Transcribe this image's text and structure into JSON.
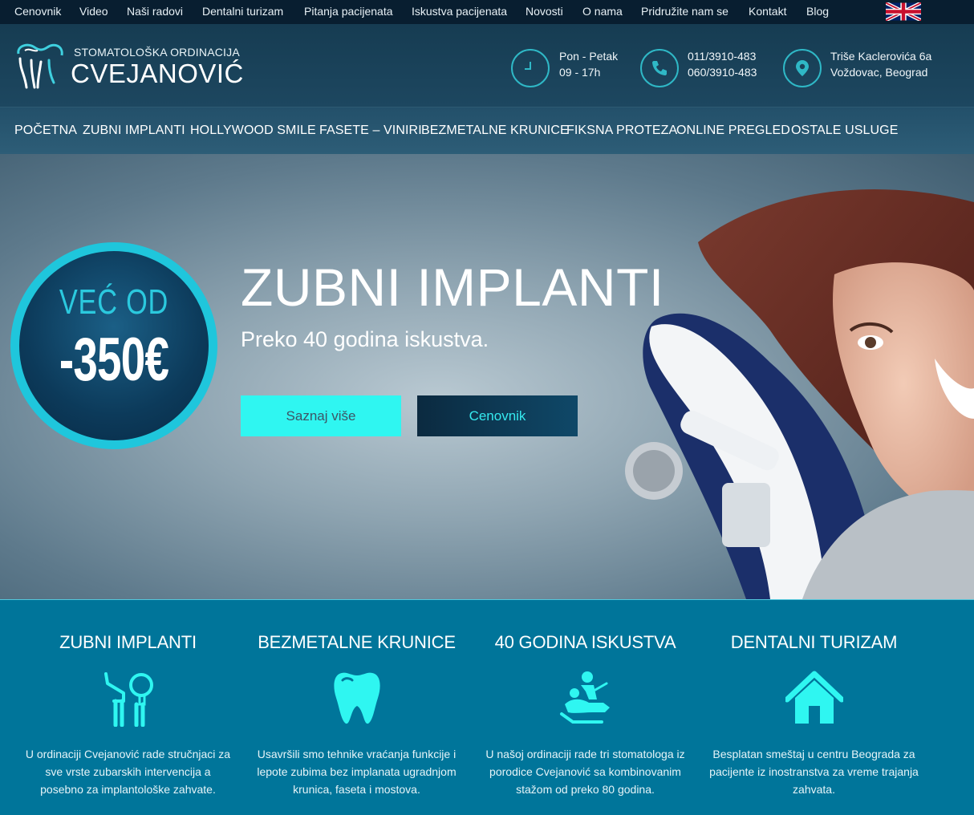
{
  "topnav": [
    "Cenovnik",
    "Video",
    "Naši radovi",
    "Dentalni turizam",
    "Pitanja pacijenata",
    "Iskustva pacijenata",
    "Novosti",
    "O nama",
    "Pridružite nam se",
    "Kontakt",
    "Blog"
  ],
  "header": {
    "logo_small": "STOMATOLOŠKA ORDINACIJA",
    "logo_big": "CVEJANOVIĆ",
    "hours": [
      "Pon - Petak",
      "09 - 17h"
    ],
    "phones": [
      "011/3910-483",
      "060/3910-483"
    ],
    "address": [
      "Triše Kaclerovića 6a",
      "Voždovac, Beograd"
    ]
  },
  "mainnav": [
    "POČETNA",
    "ZUBNI IMPLANTI",
    "HOLLYWOOD SMILE",
    "FASETE – VINIRI",
    "BEZMETALNE KRUNICE",
    "FIKSNA PROTEZA",
    "ONLINE PREGLED",
    "OSTALE USLUGE"
  ],
  "hero": {
    "badge_top": "VEĆ OD",
    "badge_price": "-350€",
    "title": "ZUBNI IMPLANTI",
    "subtitle": "Preko 40 godina iskustva.",
    "btn_more": "Saznaj više",
    "btn_prices": "Cenovnik"
  },
  "features": [
    {
      "title": "ZUBNI IMPLANTI",
      "icon": "dental-tools-icon",
      "text": "U ordinaciji Cvejanović rade stručnjaci za sve vrste zubarskih intervencija a posebno za implantološke zahvate."
    },
    {
      "title": "BEZMETALNE KRUNICE",
      "icon": "tooth-icon",
      "text": "Usavršili smo tehnike vraćanja funkcije i lepote zubima bez implanata ugradnjom krunica, faseta i mostova."
    },
    {
      "title": "40 GODINA ISKUSTVA",
      "icon": "dentist-chair-icon",
      "text": "U našoj ordinaciji rade tri stomatologa iz porodice Cvejanović sa kombinovanim stažom od preko 80 godina."
    },
    {
      "title": "DENTALNI TURIZAM",
      "icon": "house-icon",
      "text": "Besplatan smeštaj u centru Beograda za pacijente iz inostranstva za vreme trajanja zahvata."
    }
  ],
  "colors": {
    "accent": "#2ff6f1",
    "feature_bg": "#00759a",
    "topbar_bg": "#081e30",
    "badge_ring": "#1fc6dc"
  }
}
